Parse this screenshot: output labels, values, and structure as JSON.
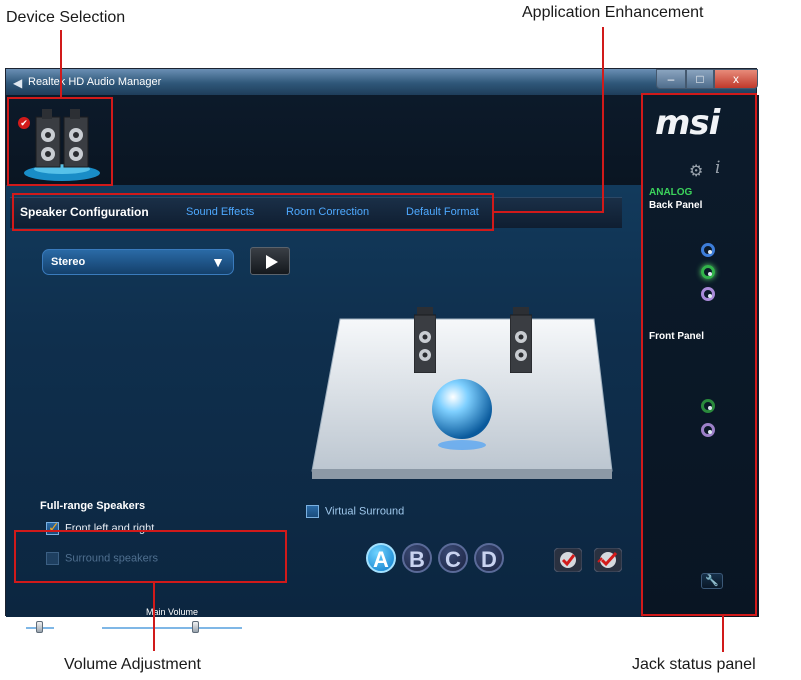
{
  "annotations": {
    "device_selection": "Device Selection",
    "application_enhancement": "Application Enhancement",
    "volume_adjustment": "Volume Adjustment",
    "jack_status_panel": "Jack status panel"
  },
  "window": {
    "title": "Realtek HD Audio Manager",
    "controls": {
      "minimize": "–",
      "maximize": "□",
      "close": "x"
    }
  },
  "tabs": [
    {
      "label": "Speaker Configuration",
      "active": true
    },
    {
      "label": "Sound Effects",
      "active": false
    },
    {
      "label": "Room Correction",
      "active": false
    },
    {
      "label": "Default Format",
      "active": false
    }
  ],
  "speaker_config": {
    "selected": "Stereo",
    "full_range_title": "Full-range Speakers",
    "front_left_right": "Front left and right",
    "surround_speakers": "Surround speakers",
    "virtual_surround": "Virtual Surround"
  },
  "volume": {
    "main_label": "Main Volume",
    "left_label": "L",
    "right_label": "R",
    "minus": "–",
    "plus": "+",
    "balance_level": 0.45,
    "main_level": 0.72
  },
  "profiles": [
    "A",
    "B",
    "C",
    "D"
  ],
  "side_panel": {
    "logo": "msi",
    "analog": "ANALOG",
    "back_panel": "Back Panel",
    "front_panel": "Front Panel"
  },
  "colors": {
    "annotation_red": "#d11a1a",
    "accent_blue": "#4ea9ff",
    "analog_green": "#3cd35c",
    "jack_blue": "#3d7dd9",
    "jack_green": "#32b34a",
    "jack_pink": "#a98ad9"
  }
}
